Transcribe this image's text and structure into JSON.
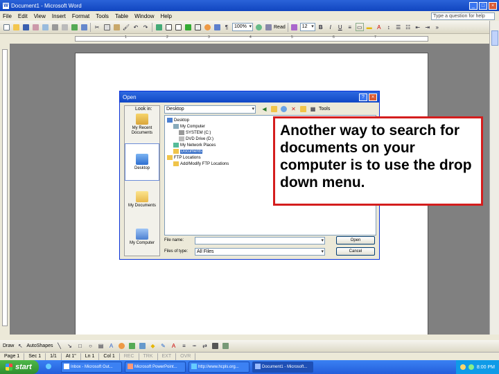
{
  "window": {
    "title": "Document1 - Microsoft Word"
  },
  "menu": [
    "File",
    "Edit",
    "View",
    "Insert",
    "Format",
    "Tools",
    "Table",
    "Window",
    "Help"
  ],
  "help_box": "Type a question for help",
  "toolbar": {
    "zoom": "100%",
    "read": "Read",
    "font_size": "12"
  },
  "ruler_marks": [
    "1",
    "2",
    "3",
    "4",
    "5",
    "6",
    "7"
  ],
  "dialog": {
    "title": "Open",
    "look_in_label": "Look in:",
    "look_in_value": "Desktop",
    "tools_label": "Tools",
    "places": [
      {
        "label": "My Recent Documents"
      },
      {
        "label": "Desktop"
      },
      {
        "label": "My Documents"
      },
      {
        "label": "My Computer"
      },
      {
        "label": "My Network Places"
      }
    ],
    "files": [
      {
        "label": "Desktop"
      },
      {
        "label": "My Computer"
      },
      {
        "label": "SYSTEM (C:)"
      },
      {
        "label": "DVD Drive (D:)"
      },
      {
        "label": "My Network Places"
      },
      {
        "label": "Documents"
      },
      {
        "label": "FTP Locations"
      },
      {
        "label": "Add/Modify FTP Locations"
      }
    ],
    "file_name_label": "File name:",
    "file_name_value": "",
    "file_type_label": "Files of type:",
    "file_type_value": "All Files",
    "open_button": "Open",
    "cancel_button": "Cancel"
  },
  "callout": {
    "text": "Another way to search for documents on your computer is to use the drop down menu."
  },
  "drawbar": {
    "draw": "Draw",
    "autoshapes": "AutoShapes"
  },
  "status": {
    "page": "Page 1",
    "sec": "Sec 1",
    "position": "1/1",
    "at": "At 1\"",
    "ln": "Ln 1",
    "col": "Col 1",
    "rec": "REC",
    "trk": "TRK",
    "ext": "EXT",
    "ovr": "OVR"
  },
  "taskbar": {
    "start": "start",
    "tasks": [
      {
        "label": "Inbox - Microsoft Out..."
      },
      {
        "label": "Microsoft PowerPoint..."
      },
      {
        "label": "http://www.hcpls.org..."
      },
      {
        "label": "Document1 - Microsoft..."
      }
    ],
    "clock": "8:00 PM"
  },
  "colors": {
    "accent": "#d41d1d",
    "titlebar": "#1145c0",
    "taskbar": "#245edb"
  }
}
